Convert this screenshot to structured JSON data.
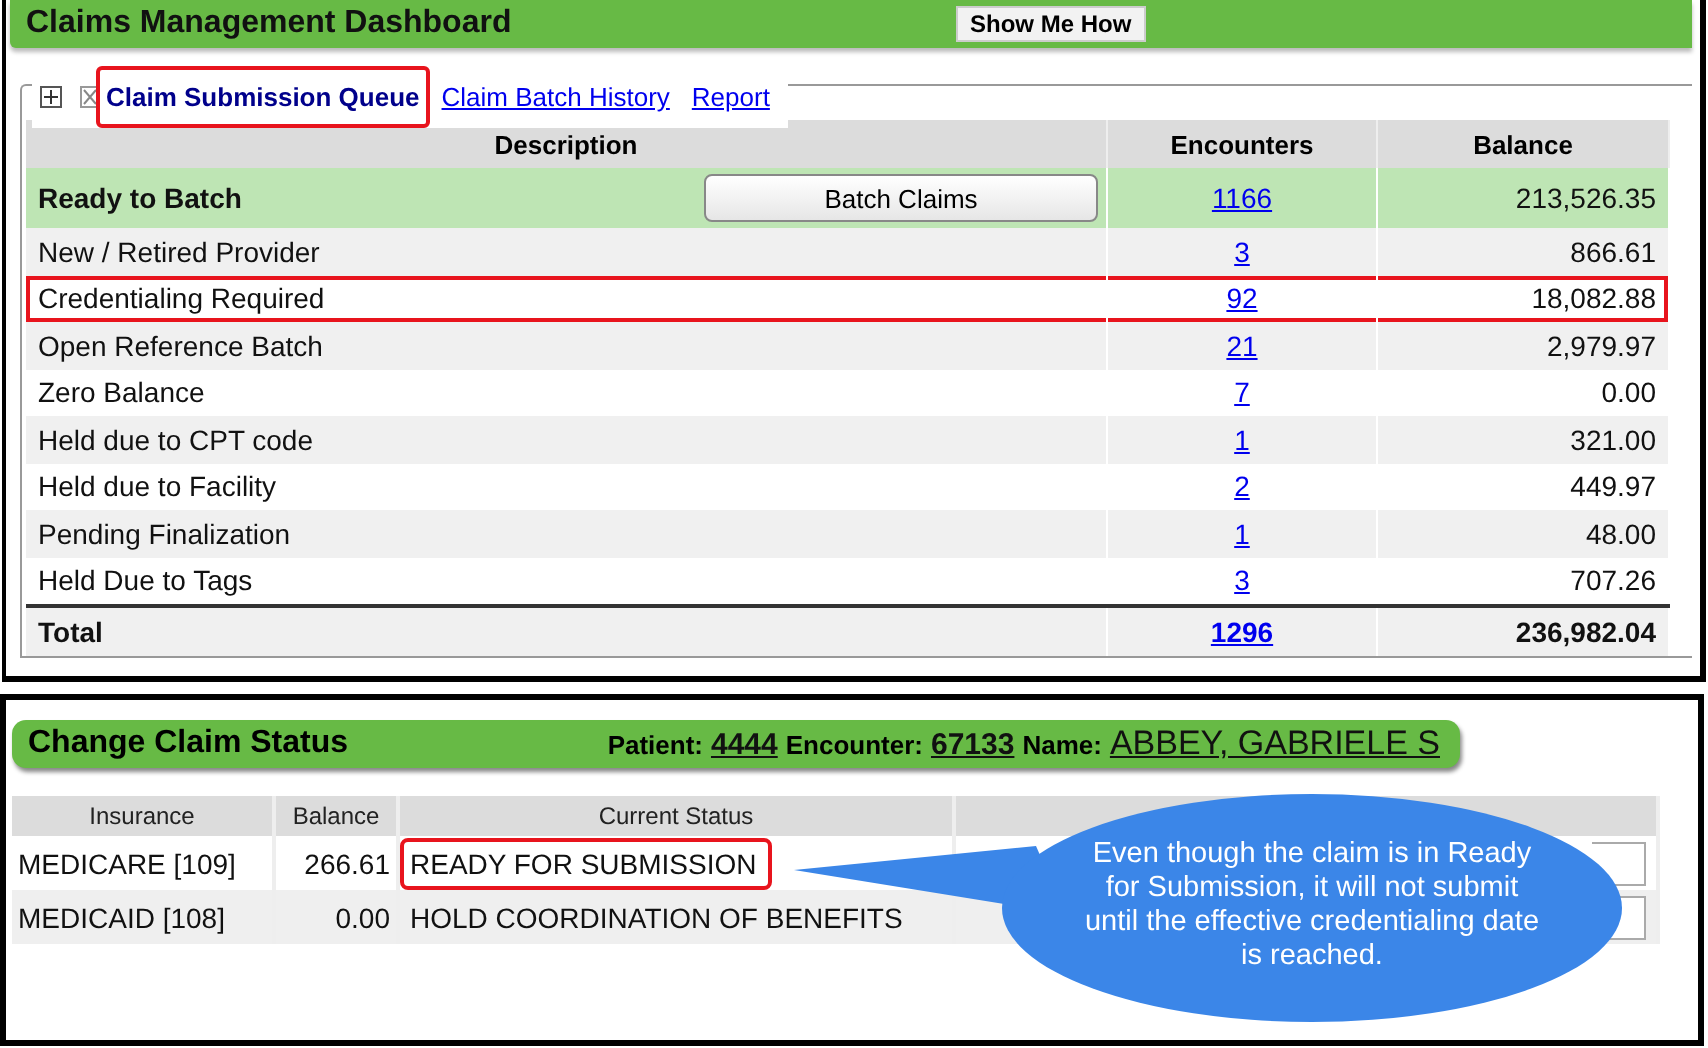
{
  "dashboard": {
    "title": "Claims Management Dashboard",
    "help_button": "Show Me How",
    "tabs": [
      {
        "label": "Claim Submission Queue",
        "selected": true,
        "highlighted": true
      },
      {
        "label": "Claim Batch History",
        "selected": false,
        "highlighted": false
      },
      {
        "label": "Report",
        "selected": false,
        "highlighted": false
      }
    ],
    "table": {
      "columns": [
        "Description",
        "Encounters",
        "Balance"
      ],
      "rows": [
        {
          "kind": "ready",
          "description": "Ready to Batch",
          "action": "Batch Claims",
          "encounters": "1166",
          "balance": "213,526.35",
          "highlighted": false
        },
        {
          "kind": "normal",
          "description": "New / Retired Provider",
          "encounters": "3",
          "balance": "866.61",
          "highlighted": false
        },
        {
          "kind": "normal",
          "description": "Credentialing Required",
          "encounters": "92",
          "balance": "18,082.88",
          "highlighted": true
        },
        {
          "kind": "normal",
          "description": "Open Reference Batch",
          "encounters": "21",
          "balance": "2,979.97",
          "highlighted": false
        },
        {
          "kind": "normal",
          "description": "Zero Balance",
          "encounters": "7",
          "balance": "0.00",
          "highlighted": false
        },
        {
          "kind": "normal",
          "description": "Held due to CPT code",
          "encounters": "1",
          "balance": "321.00",
          "highlighted": false
        },
        {
          "kind": "normal",
          "description": "Held due to Facility",
          "encounters": "2",
          "balance": "449.97",
          "highlighted": false
        },
        {
          "kind": "normal",
          "description": "Pending Finalization",
          "encounters": "1",
          "balance": "48.00",
          "highlighted": false
        },
        {
          "kind": "normal",
          "description": "Held Due to Tags",
          "encounters": "3",
          "balance": "707.26",
          "highlighted": false
        },
        {
          "kind": "total",
          "description": "Total",
          "encounters": "1296",
          "balance": "236,982.04",
          "highlighted": false
        }
      ]
    }
  },
  "claim_status": {
    "title": "Change Claim Status",
    "patient_label": "Patient:",
    "patient": "4444",
    "encounter_label": "Encounter:",
    "encounter": "67133",
    "name_label": "Name:",
    "name": "ABBEY, GABRIELE S",
    "table": {
      "columns": [
        "Insurance",
        "Balance",
        "Current Status"
      ],
      "rows": [
        {
          "insurance": "MEDICARE [109]",
          "balance": "266.61",
          "status": "READY FOR SUBMISSION",
          "highlighted": true
        },
        {
          "insurance": "MEDICAID [108]",
          "balance": "0.00",
          "status": "HOLD COORDINATION OF BENEFITS",
          "highlighted": false
        }
      ]
    }
  },
  "callout": {
    "text": "Even though the claim is in Ready for Submission, it will not submit until the effective credentialing date is reached."
  }
}
